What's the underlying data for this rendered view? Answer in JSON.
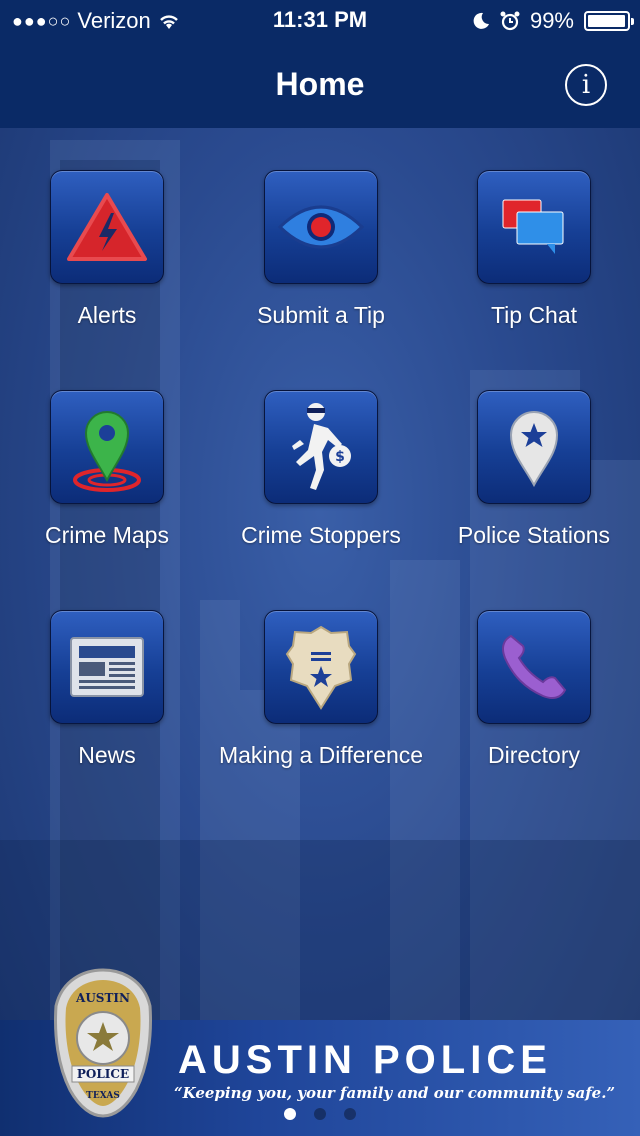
{
  "status": {
    "carrier": "Verizon",
    "time": "11:31 PM",
    "battery": "99%"
  },
  "header": {
    "title": "Home"
  },
  "tiles": [
    {
      "label": "Alerts",
      "icon": "alert-triangle-icon"
    },
    {
      "label": "Submit a Tip",
      "icon": "eye-icon"
    },
    {
      "label": "Tip Chat",
      "icon": "chat-bubbles-icon"
    },
    {
      "label": "Crime Maps",
      "icon": "map-pin-icon"
    },
    {
      "label": "Crime Stoppers",
      "icon": "robber-icon"
    },
    {
      "label": "Police Stations",
      "icon": "star-pin-icon"
    },
    {
      "label": "News",
      "icon": "newspaper-icon"
    },
    {
      "label": "Making a Difference",
      "icon": "police-badge-icon"
    },
    {
      "label": "Directory",
      "icon": "phone-icon"
    }
  ],
  "footer": {
    "brand": "AUSTIN POLICE",
    "tagline": "“Keeping you, your family and our community safe.”",
    "badge_text": [
      "AUSTIN",
      "POLICE",
      "TEXAS"
    ]
  },
  "pager": {
    "pages": 3,
    "active": 0
  },
  "colors": {
    "bar": "#0a2a66",
    "tile": "#163f95",
    "alert_red": "#d6252b",
    "pin_green": "#3cb44a"
  }
}
